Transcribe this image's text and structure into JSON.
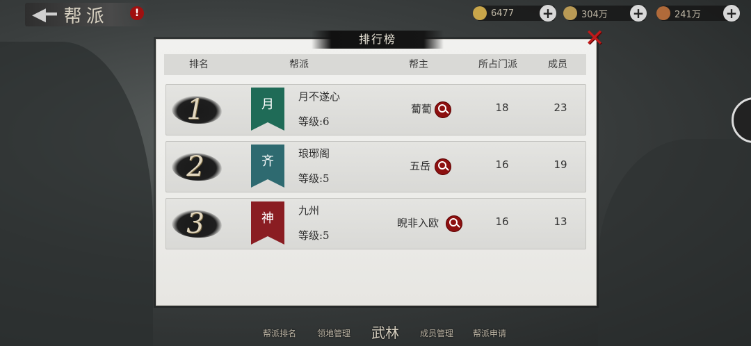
{
  "header": {
    "back_arrow": "◀━",
    "title": "帮派",
    "alert": "!"
  },
  "resources": [
    {
      "name": "gold-ingot",
      "value": "6477",
      "color": "#c9a64a"
    },
    {
      "name": "silver-coin",
      "value": "304万",
      "color": "#b99a55"
    },
    {
      "name": "copper-coin",
      "value": "241万",
      "color": "#b06a3a"
    }
  ],
  "panel": {
    "title": "排行榜",
    "close": "✕",
    "columns": [
      "排名",
      "帮派",
      "帮主",
      "所占门派",
      "成员"
    ],
    "rows": [
      {
        "rank": "1",
        "banner_char": "月",
        "banner_color": "#1f6b57",
        "name": "月不遂心",
        "level": "等级:6",
        "leader": "蔔蔔",
        "sects": "18",
        "members": "23"
      },
      {
        "rank": "2",
        "banner_char": "齐",
        "banner_color": "#2e6a70",
        "name": "琅琊阁",
        "level": "等级:5",
        "leader": "五岳",
        "sects": "16",
        "members": "19"
      },
      {
        "rank": "3",
        "banner_char": "神",
        "banner_color": "#8a1d22",
        "name": "九州",
        "level": "等级:5",
        "leader": "睨非入欧",
        "sects": "16",
        "members": "13"
      }
    ]
  },
  "bottom_nav": [
    "帮派排名",
    "领地管理",
    "武林",
    "成员管理",
    "帮派申请"
  ]
}
